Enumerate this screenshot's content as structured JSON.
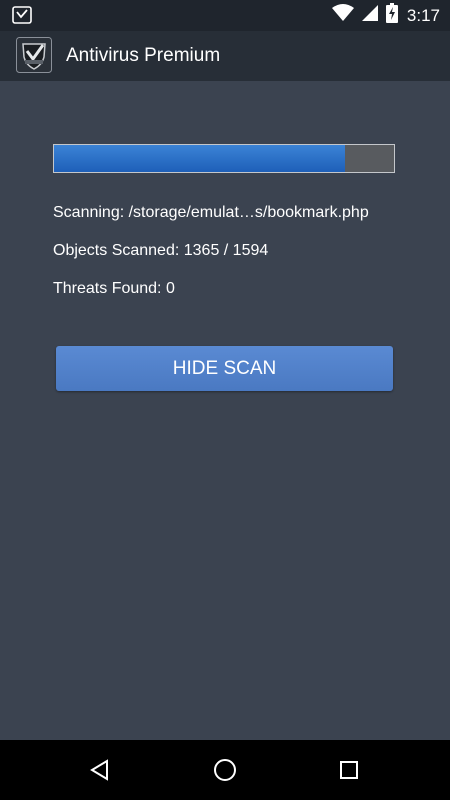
{
  "status_bar": {
    "time": "3:17",
    "icons": [
      "app-notification-icon",
      "wifi-icon",
      "cellular-signal-icon",
      "battery-charging-icon"
    ]
  },
  "action_bar": {
    "title": "Antivirus Premium",
    "logo_icon": "shield-check-logo-icon"
  },
  "scan": {
    "progress_fraction": 0.856,
    "scanning_text": "Scanning: /storage/emulat…s/bookmark.php",
    "objects_text": "Objects Scanned: 1365 / 1594",
    "threats_text": "Threats Found: 0",
    "hide_button_label": "HIDE SCAN"
  },
  "nav_bar": {
    "buttons": [
      "back-icon",
      "home-icon",
      "recents-icon"
    ]
  },
  "colors": {
    "background": "#3b4350",
    "status_bar": "#1f252d",
    "action_bar": "#272e37",
    "progress_fill": "#2a6fcb",
    "button": "#5383cc"
  }
}
